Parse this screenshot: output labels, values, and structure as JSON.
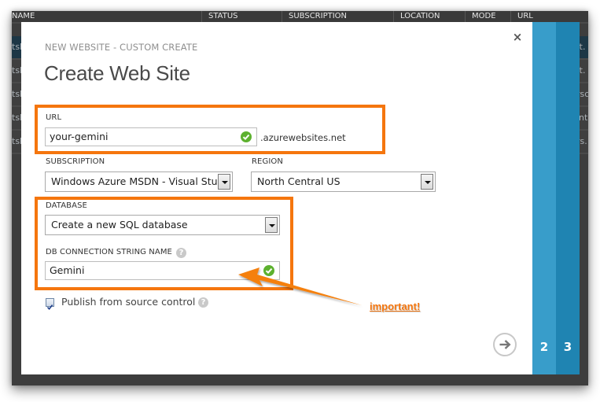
{
  "background_table": {
    "columns": [
      "NAME",
      "STATUS",
      "SUBSCRIPTION",
      "LOCATION",
      "MODE",
      "URL"
    ],
    "rows": [
      {
        "name_fragment": "tsla",
        "url_fragment": "ft."
      },
      {
        "name_fragment": "tsla",
        "url_fragment": "ft."
      },
      {
        "name_fragment": "tsla",
        "url_fragment": "rsc"
      },
      {
        "name_fragment": "tsla",
        "url_fragment": "int"
      },
      {
        "name_fragment": "tsla",
        "url_fragment": "rs."
      }
    ]
  },
  "modal": {
    "subtitle": "NEW WEBSITE - CUSTOM CREATE",
    "title": "Create Web Site",
    "close_icon": "×",
    "url": {
      "label": "URL",
      "value": "your-gemini",
      "suffix": ".azurewebsites.net",
      "valid": true
    },
    "subscription": {
      "label": "SUBSCRIPTION",
      "selected": "Windows Azure MSDN - Visual Stud"
    },
    "region": {
      "label": "REGION",
      "selected": "North Central US"
    },
    "database": {
      "label": "DATABASE",
      "selected": "Create a new SQL database"
    },
    "db_connection": {
      "label": "DB CONNECTION STRING NAME",
      "help_icon": "?",
      "value": "Gemini",
      "valid": true
    },
    "publish": {
      "label": "Publish from source control",
      "checked": true,
      "help_icon": "?"
    },
    "next_icon": "→",
    "steps": [
      "2",
      "3"
    ]
  },
  "annotation": {
    "text": "important!",
    "color": "#f5760e"
  },
  "colors": {
    "step2": "#389dca",
    "step3": "#1f84b2",
    "highlight": "#f5760e",
    "valid": "#5db12f"
  }
}
